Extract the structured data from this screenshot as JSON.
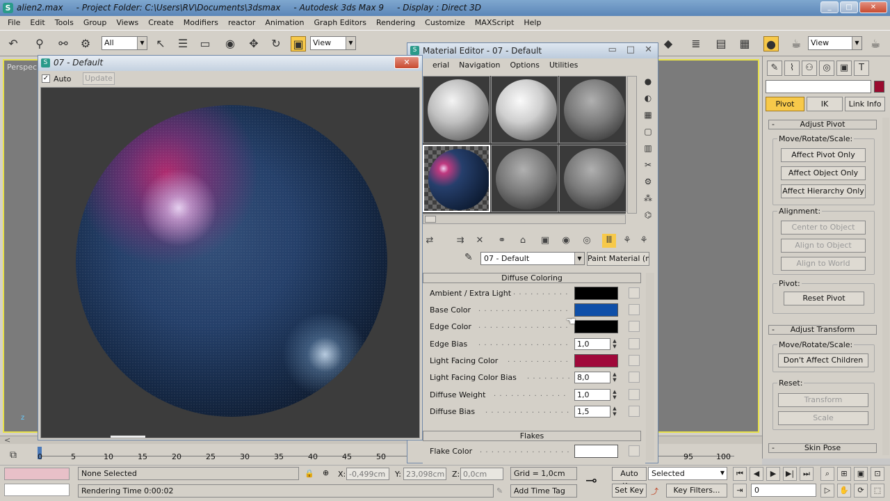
{
  "window": {
    "title": "alien2.max     - Project Folder: C:\\Users\\RV\\Documents\\3dsmax     - Autodesk 3ds Max 9     - Display : Direct 3D",
    "icon": "3dsmax-app-icon",
    "minimize": "_",
    "maximize": "□",
    "close": "✕"
  },
  "menu": [
    "File",
    "Edit",
    "Tools",
    "Group",
    "Views",
    "Create",
    "Modifiers",
    "reactor",
    "Animation",
    "Graph Editors",
    "Rendering",
    "Customize",
    "MAXScript",
    "Help"
  ],
  "toolbar": {
    "selection_filter": "All",
    "ref_coord": "View",
    "ref_coord_right": "View"
  },
  "viewport": {
    "label": "Perspec",
    "axis": "z"
  },
  "preview_window": {
    "title": "07 - Default",
    "auto_label": "Auto",
    "auto_checked": "✓",
    "update_label": "Update",
    "close": "✕"
  },
  "material_editor": {
    "title": "Material Editor - 07 - Default",
    "menu": [
      "erial",
      "Navigation",
      "Options",
      "Utilities"
    ],
    "material_name": "07 - Default",
    "paint_button": "Paint Material (mi)",
    "sections": {
      "diffuse": "Diffuse Coloring",
      "flakes": "Flakes"
    },
    "params": [
      {
        "label": "Ambient / Extra Light",
        "type": "color",
        "color": "#000000"
      },
      {
        "label": "Base Color",
        "type": "color",
        "color": "#0f4fa8"
      },
      {
        "label": "Edge Color",
        "type": "color",
        "color": "#000000"
      },
      {
        "label": "Edge Bias",
        "type": "spinner",
        "value": "1,0"
      },
      {
        "label": "Light Facing Color",
        "type": "color",
        "color": "#a0083a"
      },
      {
        "label": "Light Facing Color Bias",
        "type": "spinner",
        "value": "8,0"
      },
      {
        "label": "Diffuse Weight",
        "type": "spinner",
        "value": "1,0"
      },
      {
        "label": "Diffuse Bias",
        "type": "spinner",
        "value": "1,5"
      }
    ],
    "flake_color": {
      "label": "Flake Color",
      "color": "#ffffff"
    }
  },
  "command_panel": {
    "tabs": [
      "Pivot",
      "IK",
      "Link Info"
    ],
    "active_tab": "Pivot",
    "object_color": "#9a0a2e",
    "adjust_pivot": {
      "title": "Adjust Pivot",
      "move_group": "Move/Rotate/Scale:",
      "buttons": [
        "Affect Pivot Only",
        "Affect Object Only",
        "Affect Hierarchy Only"
      ],
      "alignment_group": "Alignment:",
      "alignment_buttons": [
        "Center to Object",
        "Align to Object",
        "Align to World"
      ],
      "pivot_group": "Pivot:",
      "reset_pivot": "Reset Pivot"
    },
    "adjust_transform": {
      "title": "Adjust Transform",
      "move_group": "Move/Rotate/Scale:",
      "dont_affect": "Don't Affect Children",
      "reset_group": "Reset:",
      "transform": "Transform",
      "scale": "Scale"
    },
    "skin_pose": "Skin Pose"
  },
  "timeline": {
    "ticks": [
      "0",
      "5",
      "10",
      "15",
      "20",
      "25",
      "30",
      "35",
      "40",
      "45",
      "50",
      "95",
      "100"
    ]
  },
  "status": {
    "selection": "None Selected",
    "rendering_time": "Rendering Time  0:00:02",
    "x_label": "X:",
    "x_value": "-0,499cm",
    "y_label": "Y:",
    "y_value": "23,098cm",
    "z_label": "Z:",
    "z_value": "0,0cm",
    "grid": "Grid = 1,0cm",
    "add_time_tag": "Add Time Tag",
    "auto_key": "Auto Key",
    "set_key": "Set Key",
    "key_mode": "Selected",
    "key_filters": "Key Filters...",
    "frame": "0"
  }
}
